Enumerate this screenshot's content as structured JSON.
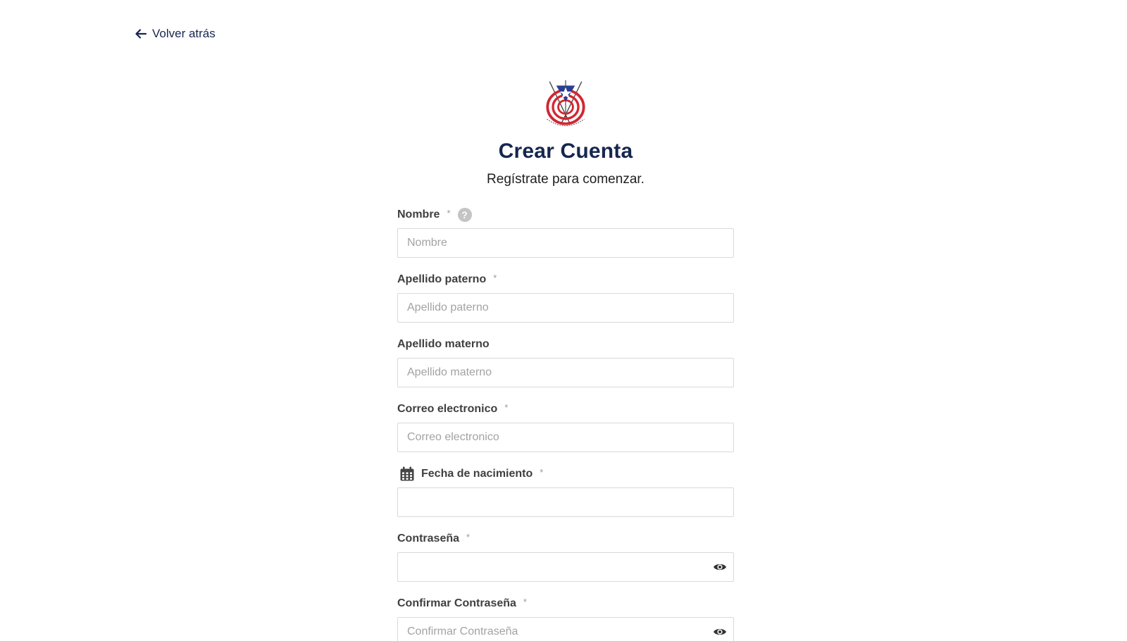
{
  "nav": {
    "back_label": "Volver atrás"
  },
  "header": {
    "title": "Crear Cuenta",
    "subtitle": "Regístrate para comenzar."
  },
  "colors": {
    "brand_navy": "#16264f",
    "flag_red": "#d22630",
    "flag_blue": "#2c3e91"
  },
  "form": {
    "required_mark": "*",
    "help_symbol": "?",
    "fields": {
      "nombre": {
        "label": "Nombre",
        "placeholder": "Nombre",
        "value": ""
      },
      "apellido_paterno": {
        "label": "Apellido paterno",
        "placeholder": "Apellido paterno",
        "value": ""
      },
      "apellido_materno": {
        "label": "Apellido materno",
        "placeholder": "Apellido materno",
        "value": ""
      },
      "correo": {
        "label": "Correo electronico",
        "placeholder": "Correo electronico",
        "value": ""
      },
      "fecha": {
        "label": "Fecha de nacimiento",
        "placeholder": "",
        "value": ""
      },
      "contrasena": {
        "label": "Contraseña",
        "placeholder": "",
        "value": ""
      },
      "confirmar": {
        "label": "Confirmar Contraseña",
        "placeholder": "Confirmar Contraseña",
        "value": ""
      }
    }
  },
  "icons": {
    "back": "arrow-left-icon",
    "help": "question-circle-icon",
    "calendar": "calendar-icon",
    "eye": "eye-icon"
  }
}
